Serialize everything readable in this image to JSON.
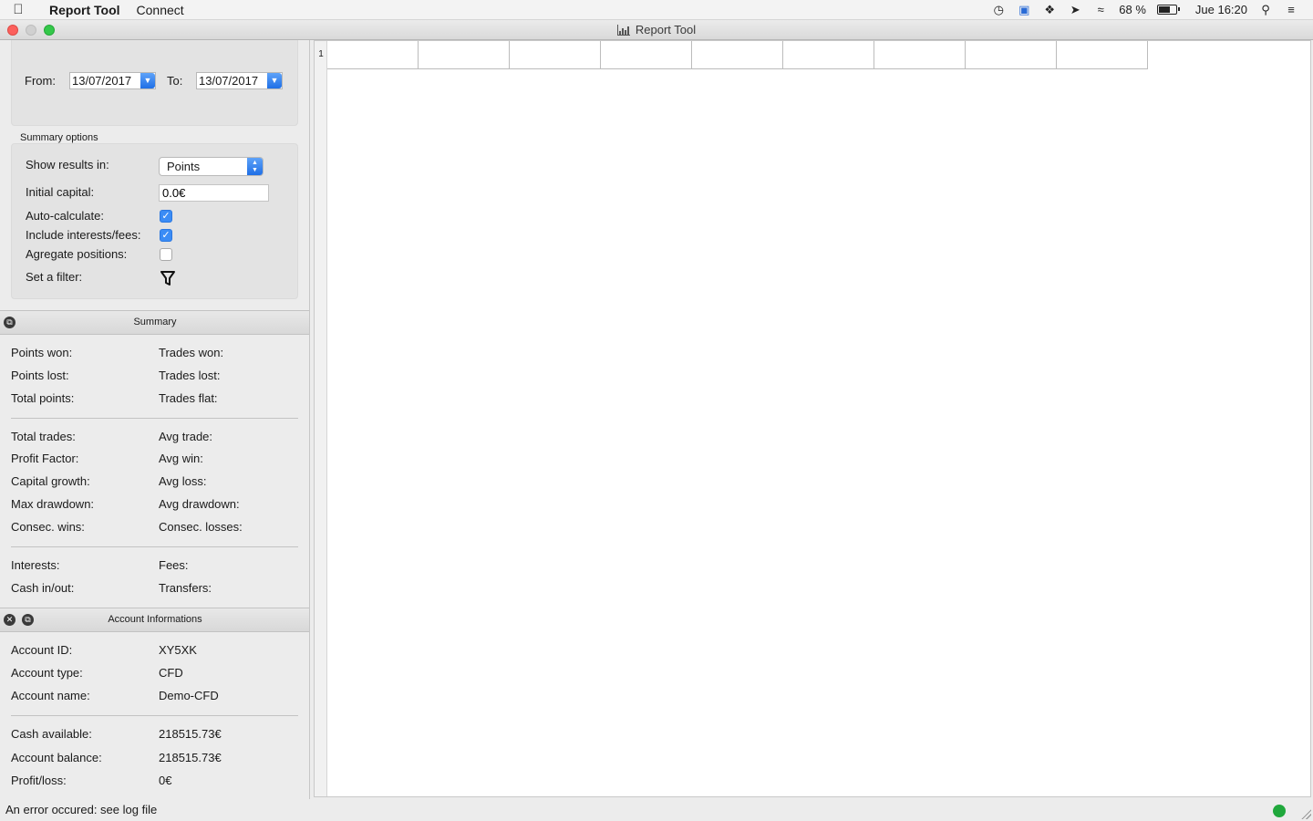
{
  "menubar": {
    "app_name": "Report Tool",
    "menus": [
      "Connect"
    ],
    "battery": "68 %",
    "battery_level": 0.68,
    "clock": "Jue 16:20",
    "status_icons": [
      "time-machine-icon",
      "sync-icon",
      "dropbox-icon",
      "location-icon",
      "wifi-icon",
      "search-icon",
      "list-icon"
    ]
  },
  "window": {
    "title": "Report Tool"
  },
  "dates": {
    "from_label": "From:",
    "from_value": "13/07/2017",
    "to_label": "To:",
    "to_value": "13/07/2017"
  },
  "summary_options": {
    "header": "Summary options",
    "show_results_label": "Show results in:",
    "show_results_value": "Points",
    "initial_capital_label": "Initial capital:",
    "initial_capital_value": "0.0€",
    "auto_calculate_label": "Auto-calculate:",
    "auto_calculate_checked": true,
    "include_fees_label": "Include interests/fees:",
    "include_fees_checked": true,
    "aggregate_label": "Agregate positions:",
    "aggregate_checked": false,
    "filter_label": "Set a filter:"
  },
  "summary": {
    "header": "Summary",
    "group1_left": [
      "Points won:",
      "Points lost:",
      "Total points:"
    ],
    "group1_right": [
      "Trades won:",
      "Trades lost:",
      "Trades flat:"
    ],
    "group2_left": [
      "Total trades:",
      "Profit Factor:",
      "Capital growth:",
      "Max drawdown:",
      "Consec. wins:"
    ],
    "group2_right": [
      "Avg trade:",
      "Avg win:",
      "Avg loss:",
      "Avg drawdown:",
      "Consec. losses:"
    ],
    "group3_left": [
      "Interests:",
      "Cash in/out:"
    ],
    "group3_right": [
      "Fees:",
      "Transfers:"
    ]
  },
  "account": {
    "header": "Account Informations",
    "rows1": [
      {
        "label": "Account ID:",
        "value": "XY5XK"
      },
      {
        "label": "Account type:",
        "value": "CFD"
      },
      {
        "label": "Account name:",
        "value": "Demo-CFD"
      }
    ],
    "rows2": [
      {
        "label": "Cash available:",
        "value": "218515.73€"
      },
      {
        "label": "Account balance:",
        "value": "218515.73€"
      },
      {
        "label": "Profit/loss:",
        "value": "0€"
      }
    ]
  },
  "grid": {
    "row_number": "1",
    "columns": 9
  },
  "status": {
    "message": "An error occured: see log file",
    "connection_color": "#20a83c"
  }
}
